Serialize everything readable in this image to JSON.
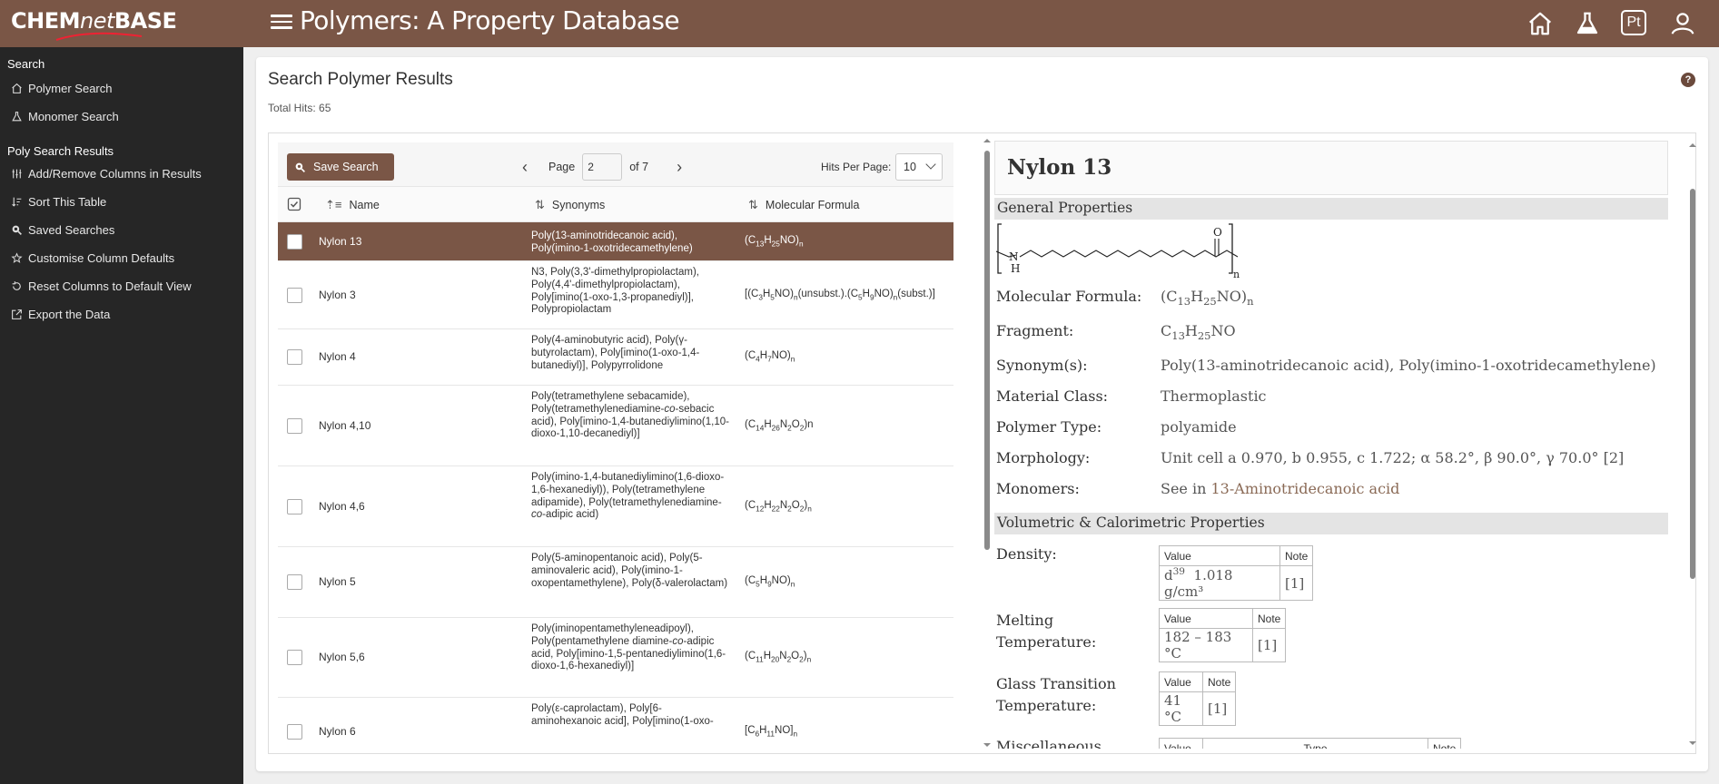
{
  "app": {
    "logo": {
      "left": "CHEM",
      "mid": "net",
      "right": "BASE"
    },
    "title": "Polymers: A Property Database"
  },
  "header_icons": [
    "home-icon",
    "flask-icon",
    "periodic-table-icon",
    "user-icon"
  ],
  "header_pt_label": "Pt",
  "sidebar": {
    "sections": [
      {
        "title": "Search",
        "items": [
          {
            "label": "Polymer Search",
            "icon": "home-icon"
          },
          {
            "label": "Monomer Search",
            "icon": "flask-icon"
          }
        ]
      },
      {
        "title": "Poly Search Results",
        "items": [
          {
            "label": "Add/Remove Columns in Results",
            "icon": "columns-icon"
          },
          {
            "label": "Sort This Table",
            "icon": "sort-icon"
          },
          {
            "label": "Saved Searches",
            "icon": "search-icon"
          },
          {
            "label": "Customise Column Defaults",
            "icon": "star-icon"
          },
          {
            "label": "Reset Columns to Default View",
            "icon": "reset-icon"
          },
          {
            "label": "Export the Data",
            "icon": "export-icon"
          }
        ]
      }
    ]
  },
  "main": {
    "title": "Search Polymer Results",
    "total_hits": "Total Hits: 65",
    "help": "?",
    "toolbar": {
      "save_label": "Save Search",
      "page_label": "Page",
      "page_value": "2",
      "page_of": "of 7",
      "hits_per_page_label": "Hits Per Page:",
      "hits_per_page_value": "10"
    },
    "columns": [
      "Name",
      "Synonyms",
      "Molecular Formula"
    ],
    "rows": [
      {
        "name": "Nylon 13",
        "synonyms": "Poly(13-aminotridecanoic acid), Poly(imino-1-oxotridecamethylene)",
        "formula_html": "(C<sub>13</sub>H<sub>25</sub>NO)<sub>n</sub>",
        "selected": true
      },
      {
        "name": "Nylon 3",
        "synonyms": "N3, Poly(3,3'-dimethylpropiolactam), Poly(4,4'-dimethylpropiolactam), Poly[imino(1-oxo-1,3-propanediyl)], Polypropiolactam",
        "formula_html": "[(C<sub>3</sub>H<sub>5</sub>NO)<sub>n</sub>(unsubst.).(C<sub>5</sub>H<sub>9</sub>NO)<sub>n</sub>(subst.)]"
      },
      {
        "name": "Nylon 4",
        "synonyms": "Poly(4-aminobutyric acid), Poly(γ-butyrolactam), Poly[imino(1-oxo-1,4-butanediyl)], Polypyrrolidone",
        "formula_html": "(C<sub>4</sub>H<sub>7</sub>NO)<sub>n</sub>"
      },
      {
        "name": "Nylon 4,10",
        "synonyms_html": "Poly(tetramethylene sebacamide), Poly(tetramethylenediamine-<i>co</i>-sebacic acid), Poly[imino-1,4-butanediylimino(1,10-dioxo-1,10-decanediyl)]",
        "formula_html": "(C<sub>14</sub>H<sub>26</sub>N<sub>2</sub>O<sub>2</sub>)n"
      },
      {
        "name": "Nylon 4,6",
        "synonyms_html": "Poly(imino-1,4-butanediylimino(1,6-dioxo-1,6-hexanediyl)), Poly(tetramethylene adipamide), Poly(tetramethylenediamine-<i>co</i>-adipic acid)",
        "formula_html": "(C<sub>12</sub>H<sub>22</sub>N<sub>2</sub>O<sub>2</sub>)<sub>n</sub>"
      },
      {
        "name": "Nylon 5",
        "synonyms": "Poly(5-aminopentanoic acid), Poly(5-aminovaleric acid), Poly(imino-1-oxopentamethylene), Poly(δ-valerolactam)",
        "formula_html": "(C<sub>5</sub>H<sub>9</sub>NO)<sub>n</sub>"
      },
      {
        "name": "Nylon 5,6",
        "synonyms_html": "Poly(iminopentamethyleneadipoyl), Poly(pentamethylene diamine-<i>co</i>-adipic acid, Poly[imino-1,5-pentanediylimino(1,6-dioxo-1,6-hexanediyl)]",
        "formula_html": "(C<sub>11</sub>H<sub>20</sub>N<sub>2</sub>O<sub>2</sub>)<sub>n</sub>"
      },
      {
        "name": "Nylon 6",
        "synonyms": "Poly(ε-caprolactam), Poly[6-aminohexanoic acid], Poly[imino(1-oxo-",
        "formula_html": "[C<sub>6</sub>H<sub>11</sub>NO]<sub>n</sub>"
      }
    ]
  },
  "details": {
    "title": "Nylon 13",
    "general_heading": "General Properties",
    "props": [
      {
        "label": "Molecular Formula:",
        "value_html": "(C<sub>13</sub>H<sub>25</sub>NO)<sub>n</sub>"
      },
      {
        "label": "Fragment:",
        "value_html": "C<sub>13</sub>H<sub>25</sub>NO"
      },
      {
        "label": "Synonym(s):",
        "value": "Poly(13-aminotridecanoic acid), Poly(imino-1-oxotridecamethylene)"
      },
      {
        "label": "Material Class:",
        "value": "Thermoplastic"
      },
      {
        "label": "Polymer Type:",
        "value": "polyamide"
      },
      {
        "label": "Morphology:",
        "value": "Unit cell a 0.970, b 0.955, c 1.722; α 58.2°, β 90.0°, γ 70.0° [2]"
      },
      {
        "label": "Monomers:",
        "prefix": "See in ",
        "link": "13-Aminotridecanoic acid"
      }
    ],
    "structure_labels": {
      "o": "O",
      "n": "N",
      "h": "H",
      "sub": "n"
    },
    "vol_heading": "Volumetric & Calorimetric Properties",
    "vol_props": [
      {
        "label1": "Density:",
        "label2": "",
        "hd_value": "Value",
        "hd_note": "Note",
        "value_html": "d<sup>39</sup>&nbsp; 1.018 g/cm³",
        "note": "[1]"
      },
      {
        "label1": "Melting",
        "label2": "Temperature:",
        "hd_value": "Value",
        "hd_note": "Note",
        "value": "182 – 183 °C",
        "note": "[1]"
      },
      {
        "label1": "Glass Transition",
        "label2": "Temperature:",
        "hd_value": "Value",
        "hd_note": "Note",
        "value": "41 °C",
        "note": "[1]"
      },
      {
        "label1": "Miscellaneous",
        "label2": "",
        "hd_value": "Value",
        "hd_type": "Type",
        "hd_note": "Note"
      }
    ]
  },
  "colors": {
    "brand": "#7a5646",
    "sidebar": "#262626",
    "link": "#8a6a56"
  }
}
